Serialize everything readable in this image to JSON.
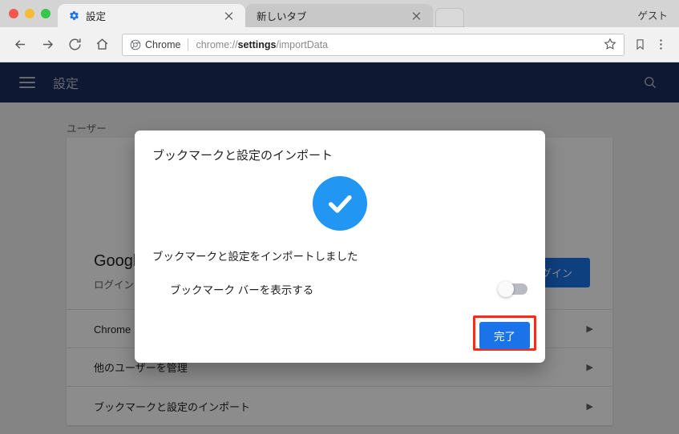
{
  "window": {
    "traffic_lights": [
      "close",
      "minimize",
      "maximize"
    ],
    "profile_label": "ゲスト"
  },
  "tabs": [
    {
      "title": "設定",
      "favicon": "gear-icon",
      "active": true,
      "close_label": "×"
    },
    {
      "title": "新しいタブ",
      "favicon": "none",
      "active": false,
      "close_label": "×"
    }
  ],
  "toolbar": {
    "back_icon": "back-arrow-icon",
    "forward_icon": "forward-arrow-icon",
    "reload_icon": "reload-icon",
    "home_icon": "home-icon",
    "chip_label": "Chrome",
    "url_prefix": "chrome://",
    "url_strong": "settings",
    "url_suffix": "/importData",
    "star_icon": "star-icon",
    "bookmark_icon": "bookmark-icon",
    "menu_icon": "three-dot-menu-icon"
  },
  "settings_header": {
    "menu_icon": "hamburger-icon",
    "title": "設定",
    "search_icon": "search-icon"
  },
  "page": {
    "section_label": "ユーザー",
    "signin": {
      "title": "Google へログイン",
      "subtitle": "ログインすると、どのデバイスでもブックマークや履歴を利用できます",
      "button_label": "ログイン"
    },
    "rows": [
      {
        "label": "Chrome の名前と画像",
        "arrow": "▶"
      },
      {
        "label": "他のユーザーを管理",
        "arrow": "▶"
      },
      {
        "label": "ブックマークと設定のインポート",
        "arrow": "▶"
      }
    ]
  },
  "dialog": {
    "title": "ブックマークと設定のインポート",
    "status_icon": "success-check-icon",
    "message": "ブックマークと設定をインポートしました",
    "toggle": {
      "label": "ブックマーク バーを表示する",
      "state": "off"
    },
    "done_label": "完了",
    "highlight_color": "#ff2b13"
  },
  "colors": {
    "accent_blue": "#1a73e8",
    "check_blue": "#2196f3",
    "header_navy": "#1b2d5b",
    "highlight_red": "#ff2b13"
  }
}
